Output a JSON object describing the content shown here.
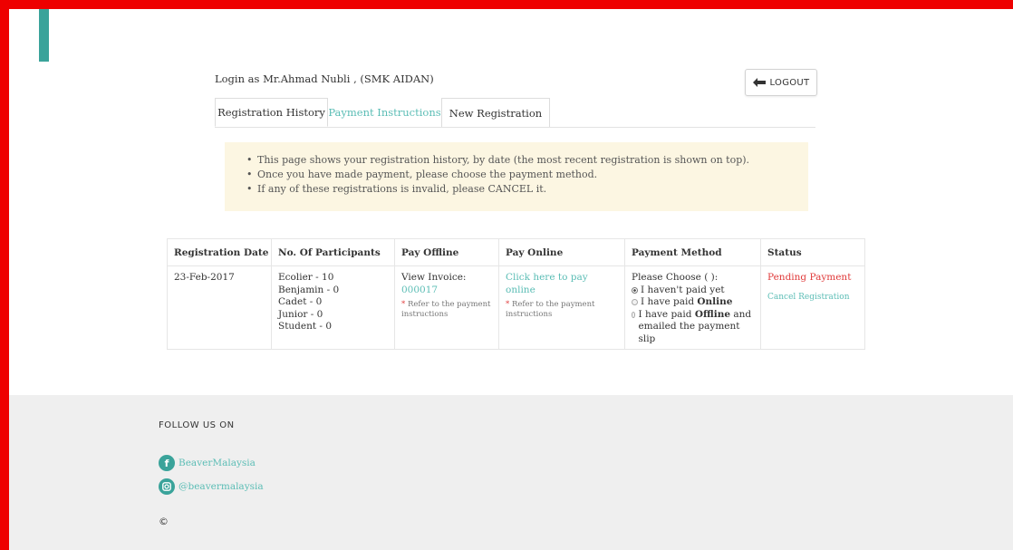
{
  "header": {
    "login_text": "Login as Mr.Ahmad Nubli , (SMK AIDAN)",
    "logout_label": "LOGOUT"
  },
  "tabs": [
    {
      "label": "Registration History",
      "active": true
    },
    {
      "label": "Payment Instructions",
      "active": false
    },
    {
      "label": "New Registration",
      "active": false
    }
  ],
  "notice": [
    "This page shows your registration history, by date (the most recent registration is shown on top).",
    "Once you have made payment, please choose the payment method.",
    "If any of these registrations is invalid, please CANCEL it."
  ],
  "table": {
    "headers": [
      "Registration Date",
      "No. Of Participants",
      "Pay Offline",
      "Pay Online",
      "Payment Method",
      "Status"
    ],
    "row": {
      "date": "23-Feb-2017",
      "participants": [
        "Ecolier - 10",
        "Benjamin - 0",
        "Cadet - 0",
        "Junior - 0",
        "Student - 0"
      ],
      "offline_label": "View Invoice: ",
      "invoice_no": "000017",
      "offline_note": "Refer to the payment instructions",
      "online_link": "Click here to pay online",
      "online_note": "Refer to the payment instructions",
      "method_prompt": "Please Choose ( ):",
      "method_options": [
        {
          "text": "I haven't paid yet",
          "bold": "",
          "rest": "",
          "checked": true
        },
        {
          "text": "I have paid ",
          "bold": "Online",
          "rest": "",
          "checked": false
        },
        {
          "text": "I have paid ",
          "bold": "Offline",
          "rest": " and emailed the payment slip",
          "checked": false
        }
      ],
      "status": "Pending Payment",
      "cancel_link": "Cancel Registration"
    }
  },
  "footer": {
    "follow_label": "FOLLOW US ON",
    "facebook": "BeaverMalaysia",
    "instagram": "@beavermalaysia",
    "copyright": "©"
  },
  "colors": {
    "accent": "#3aa39a",
    "link": "#5bbdb5",
    "alert": "#e03a3a",
    "notice_bg": "#fcf6e2",
    "frame": "#ee0000"
  }
}
